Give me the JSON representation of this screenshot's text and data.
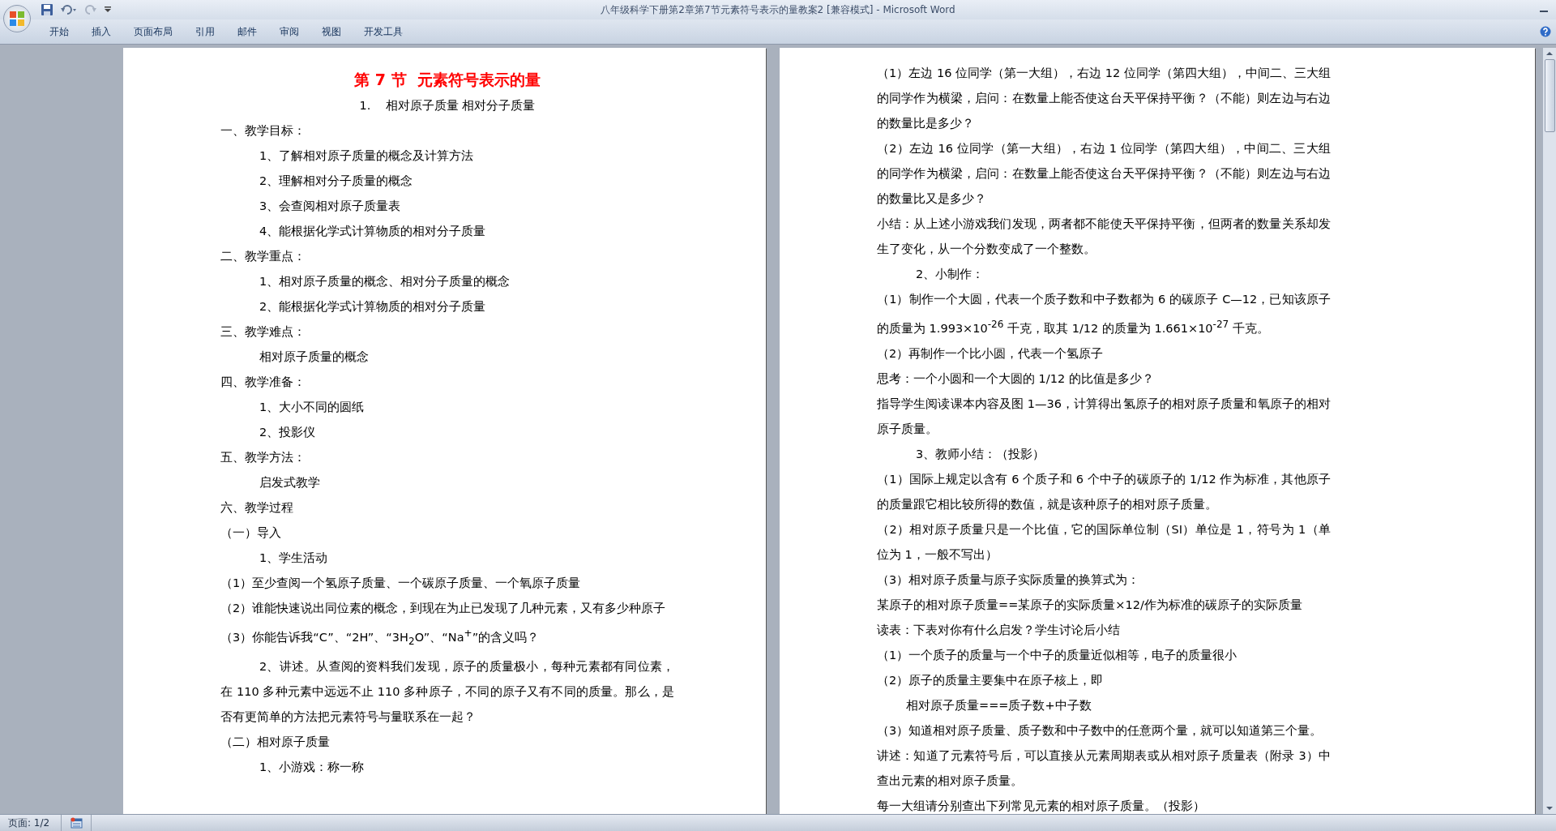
{
  "window": {
    "title": "八年级科学下册第2章第7节元素符号表示的量教案2 [兼容模式] - Microsoft Word"
  },
  "ribbon_tabs": [
    {
      "label": "开始",
      "selected": false
    },
    {
      "label": "插入",
      "selected": false
    },
    {
      "label": "页面布局",
      "selected": false
    },
    {
      "label": "引用",
      "selected": false
    },
    {
      "label": "邮件",
      "selected": false
    },
    {
      "label": "审阅",
      "selected": false
    },
    {
      "label": "视图",
      "selected": false
    },
    {
      "label": "开发工具",
      "selected": false
    }
  ],
  "pages": [
    {
      "paragraphs": [
        {
          "kind": "title",
          "text": "第 7 节  元素符号表示的量"
        },
        {
          "kind": "subtitle",
          "text": "1.    相对原子质量 相对分子质量"
        },
        {
          "kind": "plain",
          "text": "一、教学目标："
        },
        {
          "kind": "indent",
          "text": "1、了解相对原子质量的概念及计算方法"
        },
        {
          "kind": "indent",
          "text": "2、理解相对分子质量的概念"
        },
        {
          "kind": "indent",
          "text": "3、会查阅相对原子质量表"
        },
        {
          "kind": "indent",
          "text": "4、能根据化学式计算物质的相对分子质量"
        },
        {
          "kind": "plain",
          "text": "二、教学重点："
        },
        {
          "kind": "indent",
          "text": "1、相对原子质量的概念、相对分子质量的概念"
        },
        {
          "kind": "indent",
          "text": "2、能根据化学式计算物质的相对分子质量"
        },
        {
          "kind": "plain",
          "text": "三、教学难点："
        },
        {
          "kind": "indent",
          "text": "相对原子质量的概念"
        },
        {
          "kind": "plain",
          "text": "四、教学准备："
        },
        {
          "kind": "indent",
          "text": "1、大小不同的圆纸"
        },
        {
          "kind": "indent",
          "text": "2、投影仪"
        },
        {
          "kind": "plain",
          "text": "五、教学方法："
        },
        {
          "kind": "indent",
          "text": "启发式教学"
        },
        {
          "kind": "plain",
          "text": "六、教学过程"
        },
        {
          "kind": "plain",
          "text": "（一）导入"
        },
        {
          "kind": "indent",
          "text": "1、学生活动"
        },
        {
          "kind": "plain",
          "text": "（1）至少查阅一个氢原子质量、一个碳原子质量、一个氧原子质量"
        },
        {
          "kind": "plain",
          "text": "（2）谁能快速说出同位素的概念，到现在为止已发现了几种元素，又有多少种原子"
        },
        {
          "kind": "plain",
          "text": "（3）你能告诉我“C”、“2H”、“3H$_{2}$O”、“Na$^{+}$”的含义吗？"
        },
        {
          "kind": "first-indent",
          "text": "2、讲述。从查阅的资料我们发现，原子的质量极小，每种元素都有同位素，在 110 多种元素中远远不止 110 多种原子，不同的原子又有不同的质量。那么，是否有更简单的方法把元素符号与量联系在一起？"
        },
        {
          "kind": "plain",
          "text": "（二）相对原子质量"
        },
        {
          "kind": "indent",
          "text": "1、小游戏：称一称"
        }
      ]
    },
    {
      "paragraphs": [
        {
          "kind": "plain",
          "text": "（1）左边 16 位同学（第一大组），右边 12 位同学（第四大组），中间二、三大组的同学作为横梁，启问：在数量上能否使这台天平保持平衡？（不能）则左边与右边的数量比是多少？"
        },
        {
          "kind": "plain",
          "text": "（2）左边 16 位同学（第一大组），右边 1 位同学（第四大组），中间二、三大组的同学作为横梁，启问：在数量上能否使这台天平保持平衡？（不能）则左边与右边的数量比又是多少？"
        },
        {
          "kind": "plain",
          "text": "小结：从上述小游戏我们发现，两者都不能使天平保持平衡，但两者的数量关系却发生了变化，从一个分数变成了一个整数。"
        },
        {
          "kind": "indent",
          "text": "2、小制作："
        },
        {
          "kind": "plain",
          "text": "（1）制作一个大圆，代表一个质子数和中子数都为 6 的碳原子 C—12，已知该原子的质量为 1.993×10$^{-26}$ 千克，取其 1/12 的质量为 1.661×10$^{-27}$ 千克。"
        },
        {
          "kind": "plain",
          "text": "（2）再制作一个比小圆，代表一个氢原子"
        },
        {
          "kind": "plain",
          "text": "思考：一个小圆和一个大圆的 1/12 的比值是多少？"
        },
        {
          "kind": "plain",
          "text": "指导学生阅读课本内容及图 1—36，计算得出氢原子的相对原子质量和氧原子的相对原子质量。"
        },
        {
          "kind": "indent",
          "text": "3、教师小结：（投影）"
        },
        {
          "kind": "plain",
          "text": "（1）国际上规定以含有 6 个质子和 6 个中子的碳原子的 1/12 作为标准，其他原子的质量跟它相比较所得的数值，就是该种原子的相对原子质量。"
        },
        {
          "kind": "plain",
          "text": "（2）相对原子质量只是一个比值，它的国际单位制（SI）单位是 1，符号为 1（单位为 1，一般不写出）"
        },
        {
          "kind": "plain",
          "text": "（3）相对原子质量与原子实际质量的换算式为："
        },
        {
          "kind": "plain",
          "text": "某原子的相对原子质量==某原子的实际质量×12/作为标准的碳原子的实际质量"
        },
        {
          "kind": "plain",
          "text": "读表：下表对你有什么启发？学生讨论后小结"
        },
        {
          "kind": "plain",
          "text": "（1）一个质子的质量与一个中子的质量近似相等，电子的质量很小"
        },
        {
          "kind": "plain",
          "text": "（2）原子的质量主要集中在原子核上，即"
        },
        {
          "kind": "small-indent",
          "text": "相对原子质量===质子数+中子数"
        },
        {
          "kind": "plain",
          "text": "（3）知道相对原子质量、质子数和中子数中的任意两个量，就可以知道第三个量。"
        },
        {
          "kind": "plain",
          "text": "讲述：知道了元素符号后，可以直接从元素周期表或从相对原子质量表（附录 3）中查出元素的相对原子质量。"
        },
        {
          "kind": "plain",
          "text": "每一大组请分别查出下列常见元素的相对原子质量。（投影）"
        }
      ]
    }
  ],
  "status_bar": {
    "page": "页面: 1/2"
  }
}
